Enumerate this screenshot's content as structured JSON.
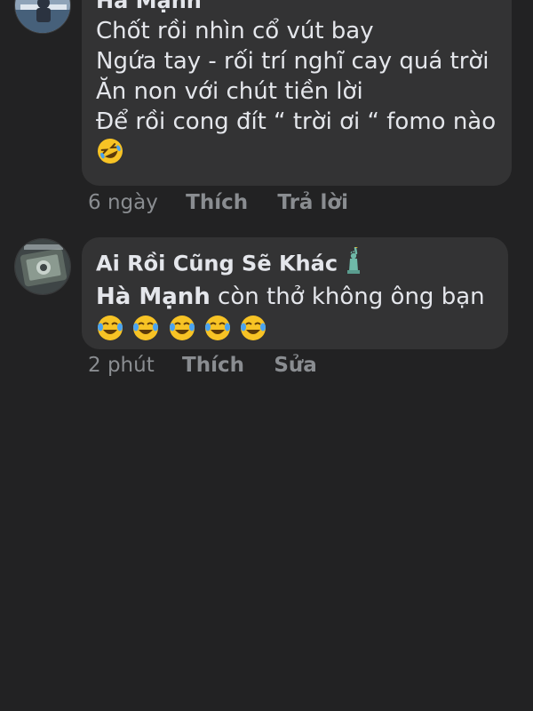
{
  "comments": [
    {
      "author": "Hà Mạnh",
      "lines": [
        "Chốt rồi nhìn cổ vút bay",
        "Ngứa tay - rối trí nghĩ cay quá trời",
        "Ăn non với chút tiền lời",
        "Để rồi cong đít “ trời ơi “ fomo nào"
      ],
      "emoji": "rolling-on-the-floor-laughing",
      "time": "6 ngày",
      "actions": [
        "Thích",
        "Trả lời"
      ]
    },
    {
      "author": "Ai Rồi Cũng Sẽ Khác",
      "author_emoji": "statue-of-liberty",
      "mention": "Hà Mạnh",
      "text": " còn thở không ông bạn",
      "emoji": "face-with-tears-of-joy",
      "emoji_count": 5,
      "time": "2 phút",
      "actions": [
        "Thích",
        "Sửa"
      ]
    }
  ]
}
